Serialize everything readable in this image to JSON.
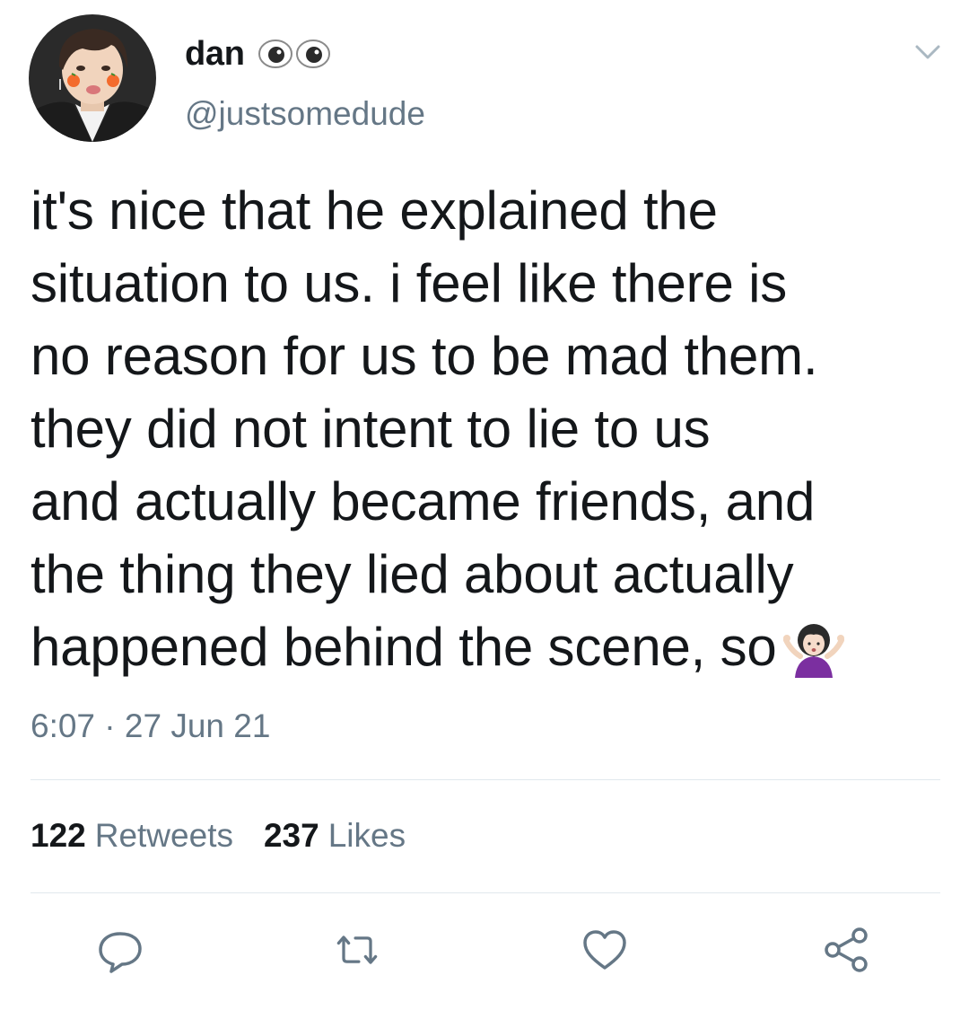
{
  "tweet": {
    "author": {
      "display_name": "dan",
      "name_emoji": [
        "eyes-icon",
        "eyes-icon"
      ],
      "handle": "@justsomedude"
    },
    "text_lines": [
      "it's nice that he explained the",
      "situation to us. i feel like there is",
      "no reason for us to be mad them.",
      "they did not intent to lie to us",
      "and actually became friends, and",
      "the thing they lied about actually",
      "happened behind the scene, so"
    ],
    "text_end_emoji": "woman-shrugging-icon",
    "timestamp": "6:07 · 27 Jun 21",
    "stats": {
      "retweets_count": "122",
      "retweets_label": "Retweets",
      "likes_count": "237",
      "likes_label": "Likes"
    },
    "actions": [
      "reply-icon",
      "retweet-icon",
      "like-icon",
      "share-icon"
    ]
  },
  "colors": {
    "text_primary": "#14171a",
    "text_secondary": "#657786",
    "divider": "#e1e8ed",
    "icon_gray": "#657786",
    "shrug_purple": "#7b2fa0"
  }
}
